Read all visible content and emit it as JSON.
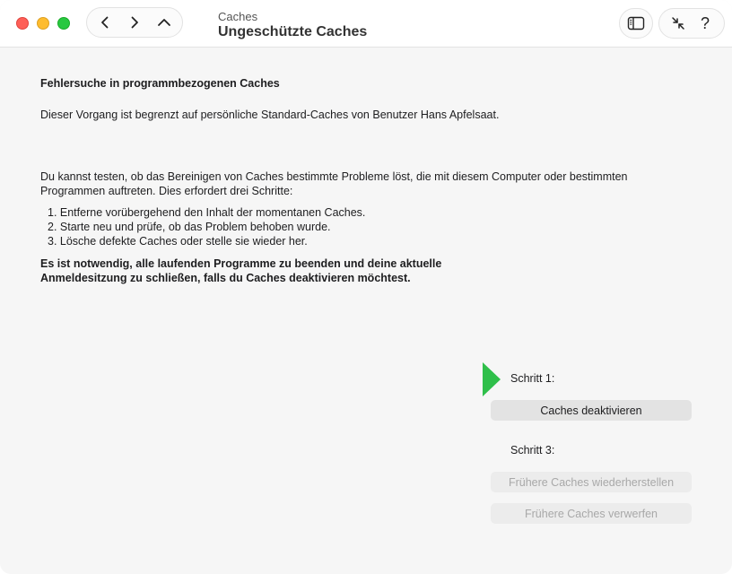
{
  "titlebar": {
    "subtitle": "Caches",
    "title": "Ungeschützte Caches",
    "help_label": "?"
  },
  "content": {
    "heading": "Fehlersuche in programmbezogenen Caches",
    "limit_text": "Dieser Vorgang ist begrenzt auf persönliche Standard-Caches von Benutzer Hans Apfelsaat.",
    "intro_text": "Du kannst testen, ob das Bereinigen von Caches bestimmte Probleme löst, die mit diesem Computer oder bestimmten Programmen auftreten. Dies erfordert drei Schritte:",
    "steps": [
      "1. Entferne vorübergehend den Inhalt der momentanen Caches.",
      "2. Starte neu und prüfe, ob das Problem behoben wurde.",
      "3. Lösche defekte Caches oder stelle sie wieder her."
    ],
    "warning_text": "Es ist notwendig, alle laufenden Programme zu beenden und deine aktuelle Anmeldesitzung zu schließen, falls du Caches deaktivieren möchtest."
  },
  "actions": {
    "step1_label": "Schritt 1:",
    "deactivate_label": "Caches deaktivieren",
    "step3_label": "Schritt 3:",
    "restore_label": "Frühere Caches wiederherstellen",
    "discard_label": "Frühere Caches verwerfen"
  },
  "colors": {
    "close": "#fe5f57",
    "minimize": "#febc2e",
    "maximize": "#28c840",
    "step_arrow": "#2fbf4a"
  },
  "icons": {
    "back": "chevron-left-icon",
    "forward": "chevron-right-icon",
    "up": "chevron-up-icon",
    "sidebar": "sidebar-icon",
    "collapse": "collapse-arrows-icon"
  }
}
